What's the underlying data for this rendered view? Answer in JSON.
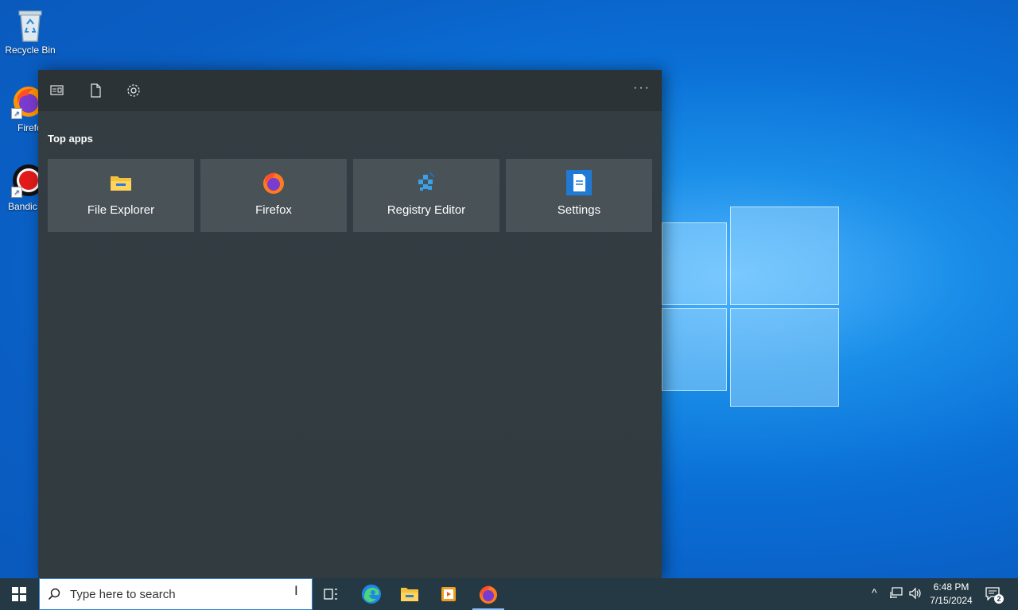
{
  "desktop": {
    "icons": [
      {
        "label": "Recycle Bin",
        "icon": "recycle-bin-icon"
      },
      {
        "label": "Firefo",
        "icon": "firefox-icon"
      },
      {
        "label": "Bandic",
        "icon": "bandicam-icon"
      }
    ]
  },
  "panel": {
    "toolbar": {
      "apps_icon": "apps-view-icon",
      "documents_icon": "documents-icon",
      "settings_icon": "gear-icon",
      "more_label": "···"
    },
    "section_title": "Top apps",
    "top_apps": [
      {
        "label": "File Explorer",
        "icon": "file-explorer-icon"
      },
      {
        "label": "Firefox",
        "icon": "firefox-icon"
      },
      {
        "label": "Registry Editor",
        "icon": "registry-editor-icon"
      },
      {
        "label": "Settings",
        "icon": "settings-app-icon"
      }
    ]
  },
  "taskbar": {
    "search": {
      "placeholder": "Type here to search"
    },
    "pinned": [
      {
        "name": "task-view",
        "icon": "task-view-icon"
      },
      {
        "name": "edge",
        "icon": "edge-icon"
      },
      {
        "name": "file-explorer",
        "icon": "folder-icon"
      },
      {
        "name": "media",
        "icon": "media-player-icon"
      },
      {
        "name": "firefox",
        "icon": "firefox-icon",
        "active": true
      }
    ],
    "tray": {
      "chevron": "^",
      "network_icon": "network-icon",
      "volume_icon": "volume-icon"
    },
    "clock": {
      "time": "6:48 PM",
      "date": "7/15/2024"
    },
    "notifications": {
      "count": "2"
    }
  },
  "colors": {
    "panel_bg": "#333d42",
    "tile_bg": "#485257",
    "taskbar_bg": "#253944",
    "accent": "#0a6fd6"
  }
}
